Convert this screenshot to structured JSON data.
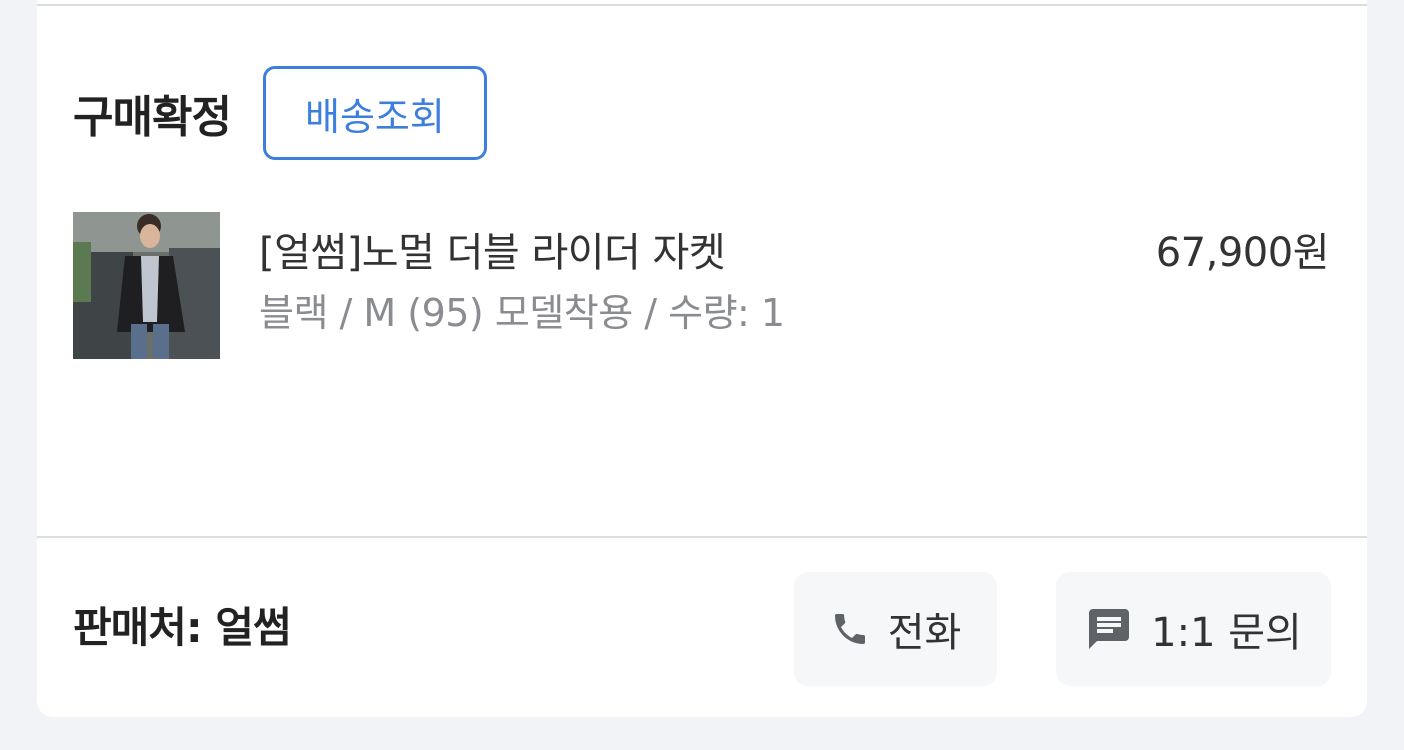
{
  "order": {
    "status": "구매확정",
    "track_button": "배송조회"
  },
  "product": {
    "name": "[얼썸]노멀 더블 라이더 자켓",
    "option": "블랙 / M (95) 모델착용  / 수량: 1",
    "price": "67,900원",
    "thumbnail_icon": "product-photo"
  },
  "seller": {
    "label": "판매처: 얼썸"
  },
  "actions": {
    "call_label": "전화",
    "call_icon": "phone-icon",
    "inquiry_label": "1:1 문의",
    "inquiry_icon": "chat-icon"
  },
  "colors": {
    "accent": "#3d7fdc",
    "background": "#f2f3f7",
    "button_bg": "#f6f7f9"
  }
}
